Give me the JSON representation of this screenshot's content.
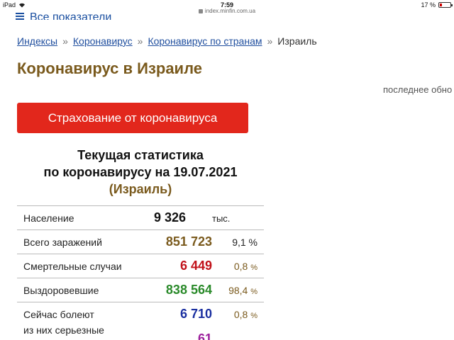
{
  "device": {
    "carrier": "iPad",
    "time": "7:59",
    "battery": "17 %"
  },
  "browser": {
    "url": "index.minfin.com.ua"
  },
  "header": {
    "all_indicators": "Все показатели"
  },
  "breadcrumb": {
    "items": [
      "Индексы",
      "Коронавирус",
      "Коронавирус по странам"
    ],
    "separator": "»",
    "current": "Израиль"
  },
  "page": {
    "title": "Коронавирус в Израиле",
    "last_update": "последнее обно"
  },
  "insurance_button": {
    "label": "Страхование от коронавируса"
  },
  "stats": {
    "title_line1": "Текущая статистика",
    "title_line2": "по коронавирусу на 19.07.2021",
    "country": "(Израиль)",
    "rows": [
      {
        "label": "Население",
        "value": "9 326",
        "unit": "тыс."
      },
      {
        "label": "Всего заражений",
        "value": "851 723",
        "pct": "9,1",
        "sign": "%"
      },
      {
        "label": "Смертельные случаи",
        "value": "6 449",
        "pct": "0,8",
        "sign": "%"
      },
      {
        "label": "Выздоровевшие",
        "value": "838 564",
        "pct": "98,4",
        "sign": "%"
      },
      {
        "label": "Сейчас болеют",
        "value": "6 710",
        "pct": "0,8",
        "sign": "%"
      },
      {
        "label": "из них серьезные",
        "value": "61"
      }
    ]
  },
  "colors": {
    "accent_red": "#e2271c",
    "title_gold": "#7a5a1d",
    "link_blue": "#1f4e9e"
  }
}
